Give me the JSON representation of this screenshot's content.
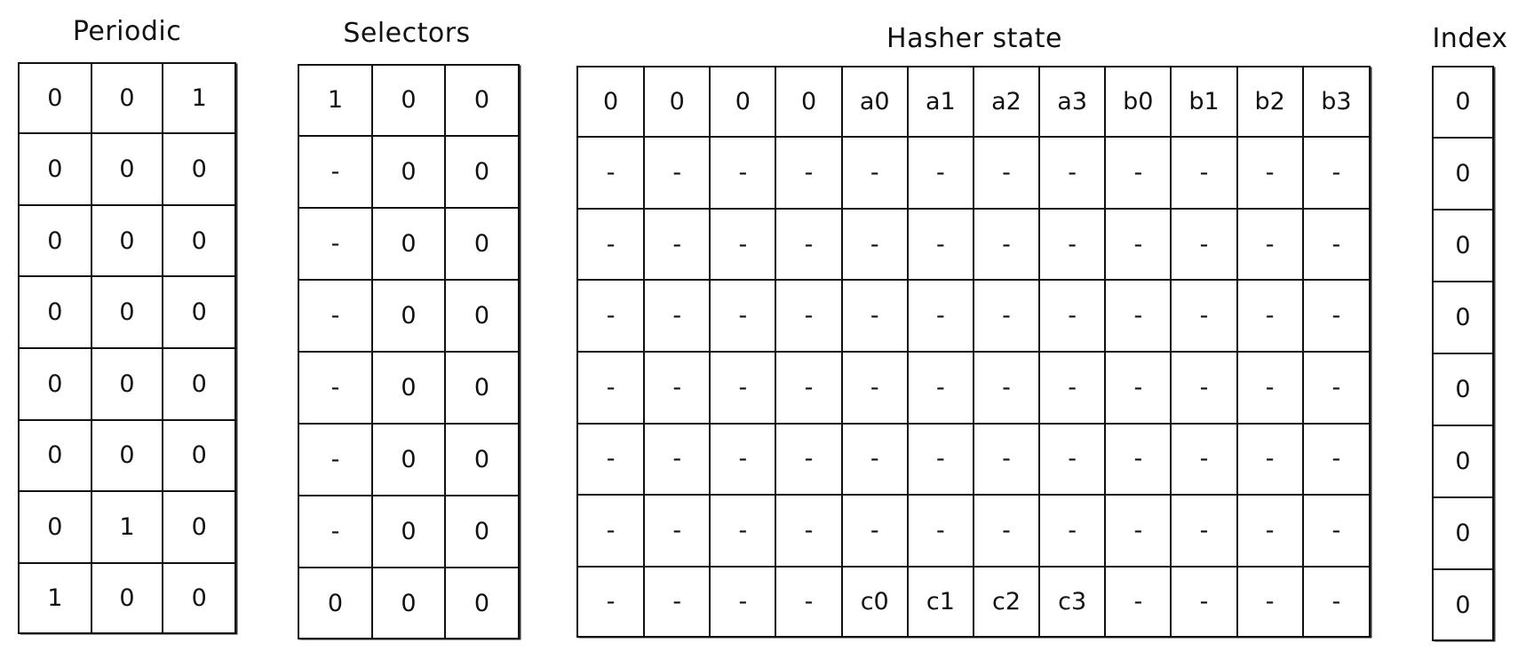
{
  "periodic": {
    "title": "Periodic",
    "rows": [
      [
        "0",
        "0",
        "1"
      ],
      [
        "0",
        "0",
        "0"
      ],
      [
        "0",
        "0",
        "0"
      ],
      [
        "0",
        "0",
        "0"
      ],
      [
        "0",
        "0",
        "0"
      ],
      [
        "0",
        "0",
        "0"
      ],
      [
        "0",
        "1",
        "0"
      ],
      [
        "1",
        "0",
        "0"
      ]
    ]
  },
  "selectors": {
    "title": "Selectors",
    "rows": [
      [
        "1",
        "0",
        "0"
      ],
      [
        "-",
        "0",
        "0"
      ],
      [
        "-",
        "0",
        "0"
      ],
      [
        "-",
        "0",
        "0"
      ],
      [
        "-",
        "0",
        "0"
      ],
      [
        "-",
        "0",
        "0"
      ],
      [
        "-",
        "0",
        "0"
      ],
      [
        "0",
        "0",
        "0"
      ]
    ]
  },
  "hasher": {
    "title": "Hasher state",
    "rows": [
      [
        "0",
        "0",
        "0",
        "0",
        "a0",
        "a1",
        "a2",
        "a3",
        "b0",
        "b1",
        "b2",
        "b3"
      ],
      [
        "-",
        "-",
        "-",
        "-",
        "-",
        "-",
        "-",
        "-",
        "-",
        "-",
        "-",
        "-"
      ],
      [
        "-",
        "-",
        "-",
        "-",
        "-",
        "-",
        "-",
        "-",
        "-",
        "-",
        "-",
        "-"
      ],
      [
        "-",
        "-",
        "-",
        "-",
        "-",
        "-",
        "-",
        "-",
        "-",
        "-",
        "-",
        "-"
      ],
      [
        "-",
        "-",
        "-",
        "-",
        "-",
        "-",
        "-",
        "-",
        "-",
        "-",
        "-",
        "-"
      ],
      [
        "-",
        "-",
        "-",
        "-",
        "-",
        "-",
        "-",
        "-",
        "-",
        "-",
        "-",
        "-"
      ],
      [
        "-",
        "-",
        "-",
        "-",
        "-",
        "-",
        "-",
        "-",
        "-",
        "-",
        "-",
        "-"
      ],
      [
        "-",
        "-",
        "-",
        "-",
        "c0",
        "c1",
        "c2",
        "c3",
        "-",
        "-",
        "-",
        "-"
      ]
    ]
  },
  "index": {
    "title": "Index",
    "rows": [
      [
        "0"
      ],
      [
        "0"
      ],
      [
        "0"
      ],
      [
        "0"
      ],
      [
        "0"
      ],
      [
        "0"
      ],
      [
        "0"
      ],
      [
        "0"
      ]
    ]
  }
}
